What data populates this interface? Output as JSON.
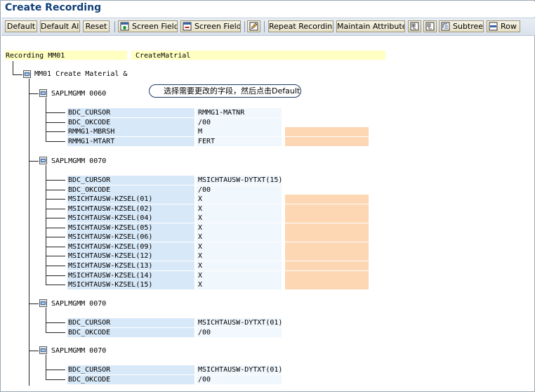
{
  "window": {
    "title": "Create Recording"
  },
  "toolbar": {
    "default_label": "Default",
    "default_all_label": "Default All",
    "reset_label": "Reset",
    "screen_field_insert_label": "Screen Field",
    "screen_field_delete_label": "Screen Field",
    "repeat_recording_label": "Repeat Recording",
    "maintain_attributes_label": "Maintain Attributes",
    "subtree_label": "Subtree",
    "row_label": "Row"
  },
  "recording": {
    "name": "Recording MM01",
    "description": "CreateMatrial"
  },
  "transaction": {
    "label": "MM01 Create Material &"
  },
  "tooltip": {
    "text": "选择需要更改的字段，然后点击Default"
  },
  "screens": [
    {
      "label": "SAPLMGMM 0060",
      "fields": [
        {
          "name": "BDC_CURSOR",
          "value": "RMMG1-MATNR"
        },
        {
          "name": "BDC_OKCODE",
          "value": "/00"
        },
        {
          "name": "RMMG1-MBRSH",
          "value": "M"
        },
        {
          "name": "RMMG1-MTART",
          "value": "FERT"
        }
      ]
    },
    {
      "label": "SAPLMGMM 0070",
      "fields": [
        {
          "name": "BDC_CURSOR",
          "value": "MSICHTAUSW-DYTXT(15)"
        },
        {
          "name": "BDC_OKCODE",
          "value": "/00"
        },
        {
          "name": "MSICHTAUSW-KZSEL(01)",
          "value": "X"
        },
        {
          "name": "MSICHTAUSW-KZSEL(02)",
          "value": "X"
        },
        {
          "name": "MSICHTAUSW-KZSEL(04)",
          "value": "X"
        },
        {
          "name": "MSICHTAUSW-KZSEL(05)",
          "value": "X"
        },
        {
          "name": "MSICHTAUSW-KZSEL(06)",
          "value": "X"
        },
        {
          "name": "MSICHTAUSW-KZSEL(09)",
          "value": "X"
        },
        {
          "name": "MSICHTAUSW-KZSEL(12)",
          "value": "X"
        },
        {
          "name": "MSICHTAUSW-KZSEL(13)",
          "value": "X"
        },
        {
          "name": "MSICHTAUSW-KZSEL(14)",
          "value": "X"
        },
        {
          "name": "MSICHTAUSW-KZSEL(15)",
          "value": "X"
        }
      ]
    },
    {
      "label": "SAPLMGMM 0070",
      "fields": [
        {
          "name": "BDC_CURSOR",
          "value": "MSICHTAUSW-DYTXT(01)"
        },
        {
          "name": "BDC_OKCODE",
          "value": "/00"
        }
      ]
    },
    {
      "label": "SAPLMGMM 0070",
      "fields": [
        {
          "name": "BDC_CURSOR",
          "value": "MSICHTAUSW-DYTXT(01)"
        },
        {
          "name": "BDC_OKCODE",
          "value": "/00"
        }
      ]
    }
  ]
}
